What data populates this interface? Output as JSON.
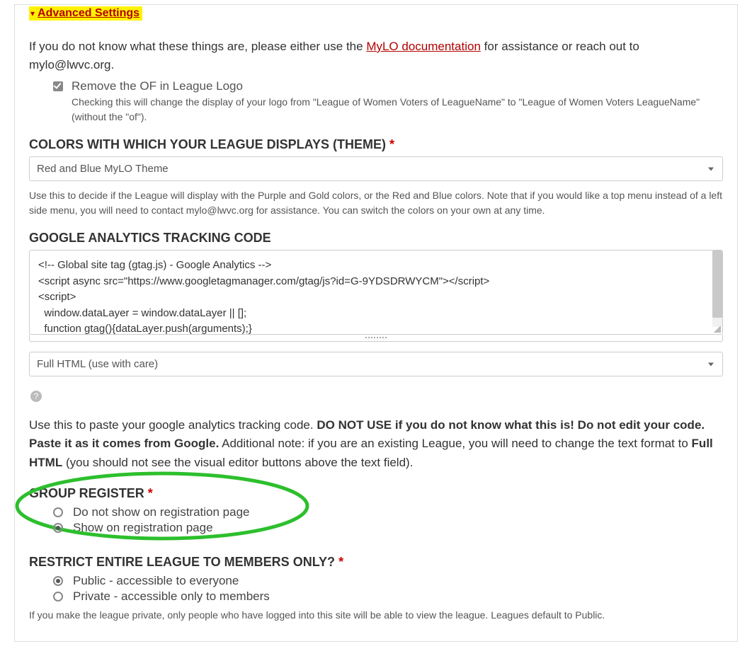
{
  "advanced": {
    "title": "Advanced Settings"
  },
  "intro": {
    "prefix": "If you do not know what these things are, please either use the ",
    "link": "MyLO documentation",
    "suffix": " for assistance or reach out to mylo@lwvc.org."
  },
  "remove_of": {
    "label": "Remove the OF in League Logo",
    "help": "Checking this will change the display of your logo from \"League of Women Voters of LeagueName\" to \"League of Women Voters LeagueName\" (without the \"of\")."
  },
  "theme": {
    "heading": "COLORS WITH WHICH YOUR LEAGUE DISPLAYS (THEME)",
    "selected": "Red and Blue MyLO Theme",
    "help": "Use this to decide if the League will display with the Purple and Gold colors, or the Red and Blue colors. Note that if you would like a top menu instead of a left side menu, you will need to contact mylo@lwvc.org for assistance. You can switch the colors on your own at any time."
  },
  "ga": {
    "heading": "GOOGLE ANALYTICS TRACKING CODE",
    "code": "<!-- Global site tag (gtag.js) - Google Analytics -->\n<script async src=\"https://www.googletagmanager.com/gtag/js?id=G-9YDSDRWYCM\"></script>\n<script>\n  window.dataLayer = window.dataLayer || [];\n  function gtag(){dataLayer.push(arguments);}",
    "format_selected": "Full HTML (use with care)",
    "help_prefix": "Use this to paste your google analytics tracking code. ",
    "help_bold1": "DO NOT USE if you do not know what this is! Do not edit your code. Paste it as it comes from Google.",
    "help_mid": " Additional note: if you are an existing League, you will need to change the text format to ",
    "help_bold2": "Full HTML",
    "help_suffix": " (you should not see the visual editor buttons above the text field)."
  },
  "group_register": {
    "heading": "GROUP REGISTER",
    "opt1": "Do not show on registration page",
    "opt2": "Show on registration page"
  },
  "restrict": {
    "heading": "RESTRICT ENTIRE LEAGUE TO MEMBERS ONLY?",
    "opt1": "Public - accessible to everyone",
    "opt2": "Private - accessible only to members",
    "help": "If you make the league private, only people who have logged into this site will be able to view the league. Leagues default to Public."
  },
  "asterisk": "*"
}
